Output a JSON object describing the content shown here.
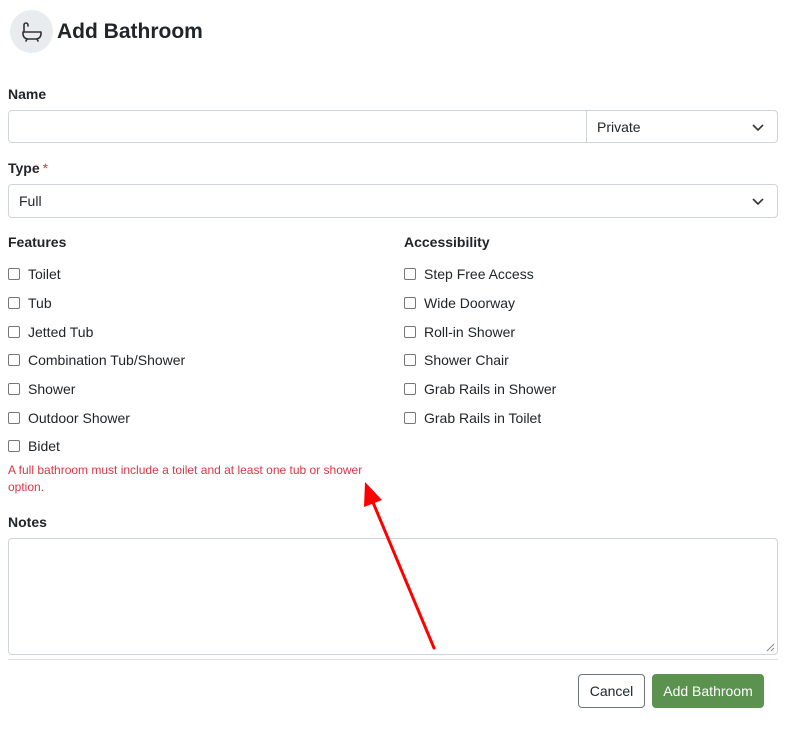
{
  "header": {
    "title": "Add Bathroom",
    "icon": "bathtub-icon"
  },
  "name_field": {
    "label": "Name",
    "value": "",
    "placeholder": ""
  },
  "privacy_select": {
    "value": "Private"
  },
  "type_field": {
    "label": "Type",
    "required_mark": "*",
    "value": "Full"
  },
  "features": {
    "title": "Features",
    "items": [
      "Toilet",
      "Tub",
      "Jetted Tub",
      "Combination Tub/Shower",
      "Shower",
      "Outdoor Shower",
      "Bidet"
    ]
  },
  "accessibility": {
    "title": "Accessibility",
    "items": [
      "Step Free Access",
      "Wide Doorway",
      "Roll-in Shower",
      "Shower Chair",
      "Grab Rails in Shower",
      "Grab Rails in Toilet"
    ]
  },
  "validation": {
    "message": "A full bathroom must include a toilet and at least one tub or shower option."
  },
  "notes_field": {
    "label": "Notes",
    "value": ""
  },
  "actions": {
    "cancel_label": "Cancel",
    "submit_label": "Add Bathroom"
  },
  "colors": {
    "error": "#dc3545",
    "primary": "#5b9250",
    "annotation_arrow": "#ff0000"
  }
}
